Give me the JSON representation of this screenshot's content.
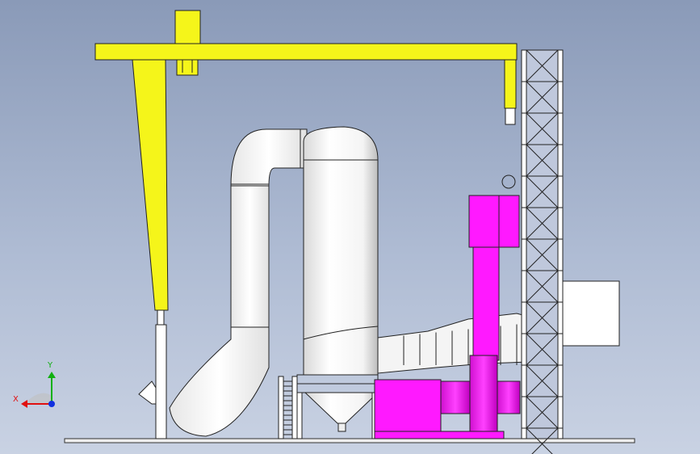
{
  "viewport": {
    "background_top": "#8a9ab8",
    "background_bottom": "#c9d2e3"
  },
  "colors": {
    "crane": "#f5f51a",
    "fan_unit": "#ff19ff",
    "duct": "#ffffff",
    "outline": "#222222",
    "axis_x": "#e01010",
    "axis_y": "#10b010",
    "axis_z": "#1030e0"
  },
  "triad": {
    "x_label": "X",
    "y_label": "Y"
  },
  "icons": {
    "triad": "coordinate-triad-icon"
  }
}
